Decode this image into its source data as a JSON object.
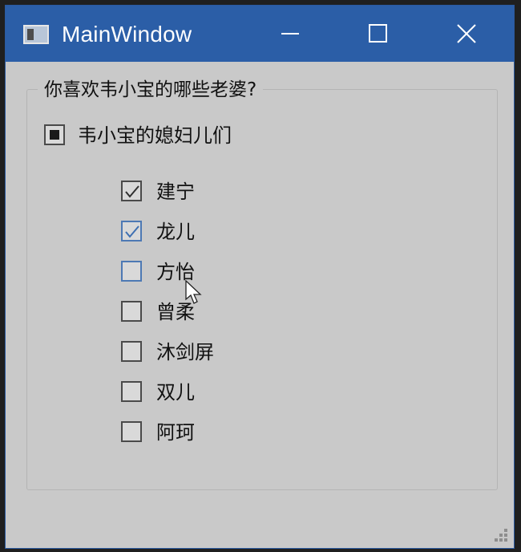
{
  "window": {
    "title": "MainWindow",
    "accent_color": "#2b5ea7",
    "background_color": "#c9c9c9"
  },
  "titlebar": {
    "app_icon": "app-window-icon",
    "buttons": [
      {
        "name": "minimize",
        "icon": "minimize-icon"
      },
      {
        "name": "maximize",
        "icon": "maximize-icon"
      },
      {
        "name": "close",
        "icon": "close-icon"
      }
    ]
  },
  "group": {
    "title": "你喜欢韦小宝的哪些老婆?",
    "parent": {
      "label": "韦小宝的媳妇儿们",
      "state": "partial"
    },
    "children": [
      {
        "label": "建宁",
        "checked": true
      },
      {
        "label": "龙儿",
        "checked": true
      },
      {
        "label": "方怡",
        "checked": false
      },
      {
        "label": "曾柔",
        "checked": false
      },
      {
        "label": "沐剑屏",
        "checked": false
      },
      {
        "label": "双儿",
        "checked": false
      },
      {
        "label": "阿珂",
        "checked": false
      }
    ]
  }
}
